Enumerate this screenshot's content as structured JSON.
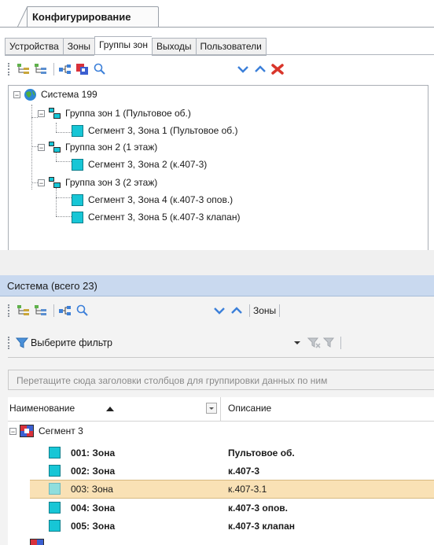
{
  "document_tab": {
    "title": "Конфигурирование"
  },
  "tabs": [
    {
      "label": "Устройства"
    },
    {
      "label": "Зоны"
    },
    {
      "label": "Группы зон",
      "active": true
    },
    {
      "label": "Выходы"
    },
    {
      "label": "Пользователи"
    }
  ],
  "tree": {
    "root": {
      "label": "Система 199"
    },
    "groups": [
      {
        "label": "Группа зон 1 (Пультовое об.)",
        "zones": [
          "Сегмент 3, Зона 1 (Пультовое об.)"
        ]
      },
      {
        "label": "Группа зон 2 (1 этаж)",
        "zones": [
          "Сегмент 3, Зона 2 (к.407-3)"
        ]
      },
      {
        "label": "Группа зон 3 (2 этаж)",
        "zones": [
          "Сегмент 3, Зона 4 (к.407-3 опов.)",
          "Сегмент 3, Зона 5 (к.407-3 клапан)"
        ]
      }
    ]
  },
  "lower": {
    "header": "Система (всего 23)",
    "toolbar_label": "Зоны",
    "filter_placeholder": "Выберите фильтр",
    "group_hint": "Перетащите сюда заголовки столбцов для группировки данных по ним",
    "columns": {
      "name": "Наименование",
      "description": "Описание"
    },
    "segment": "Сегмент 3",
    "rows": [
      {
        "name": "001: Зона",
        "description": "Пультовое об.",
        "bold": true
      },
      {
        "name": "002: Зона",
        "description": "к.407-3",
        "bold": true
      },
      {
        "name": "003: Зона",
        "description": "к.407-3.1",
        "bold": false,
        "selected": true
      },
      {
        "name": "004: Зона",
        "description": "к.407-3 опов.",
        "bold": true
      },
      {
        "name": "005: Зона",
        "description": "к.407-3 клапан",
        "bold": true
      }
    ]
  },
  "colors": {
    "zone": "#17c6d6",
    "header": "#c9d9ef",
    "selection": "#f9e1b5",
    "arrows": "#3b7fd9",
    "delete": "#d9352a"
  }
}
